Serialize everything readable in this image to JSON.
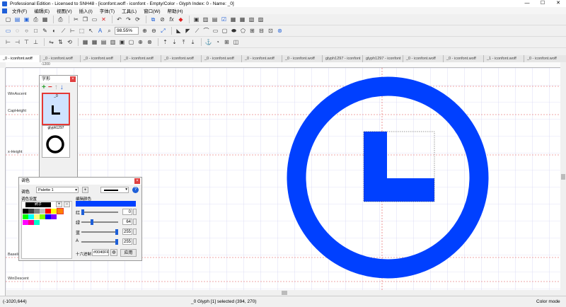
{
  "window": {
    "title": "Professional Edition - Licensed to SNH48 - [iconfont.woff - iconfont - Empty/Color - Glyph Index: 0 - Name: _0]"
  },
  "window_controls": {
    "minimize": "—",
    "maximize": "☐",
    "close": "✕"
  },
  "menu": [
    "文件(F)",
    "编辑(E)",
    "视图(V)",
    "插入(I)",
    "字体(T)",
    "工具(L)",
    "窗口(W)",
    "帮助(H)"
  ],
  "toolbar": {
    "zoom_value": "98.55%",
    "fx_label": "fx"
  },
  "tabs": [
    "_0 - iconfont.woff",
    "_0 - iconfont.woff",
    "_0 - iconfont.woff",
    "_0 - iconfont.woff",
    "_0 - iconfont.woff",
    "_0 - iconfont.woff",
    "_0 - iconfont.woff",
    "_0 - iconfont.woff",
    "glyph1297 - iconfont",
    "glyph1297 - iconfont",
    "_0 - iconfont.woff",
    "_0 - iconfont.woff",
    "_1 - iconfont.woff",
    "_0 - iconfont.woff"
  ],
  "ruler": {
    "left_label": "-1200"
  },
  "metrics": {
    "win_ascent": "WinAscent",
    "cap_height": "CapHeight",
    "x_height": "x-Height",
    "baseline": "Baseline",
    "win_descent": "WinDescent"
  },
  "glyphs_panel": {
    "title": "字形",
    "glyphs": [
      {
        "name": "_0",
        "selected": true
      },
      {
        "name": "glyph1297",
        "selected": false
      }
    ]
  },
  "palette_panel": {
    "title": "调色",
    "label": "调色",
    "palette_select": "Palette 1",
    "palette_settings_label": "调色设置",
    "brush_label": "刷子",
    "edit_color_label": "编辑颜色",
    "hex_label": "十六进制",
    "hex_value": "#0040FF",
    "apply_button": "应用",
    "channels": [
      {
        "label": "红",
        "value": "0"
      },
      {
        "label": "绿",
        "value": "64"
      },
      {
        "label": "蓝",
        "value": "255"
      },
      {
        "label": "A",
        "value": "255"
      }
    ],
    "channel_levels": [
      0,
      0.25,
      1,
      1
    ],
    "swatches": [
      "#000000",
      "#404040",
      "#808080",
      "#c0c0c0",
      "#ff0000",
      "#ffff00",
      "#ff8000",
      "#00ff00",
      "#00ffff",
      "#ffff80",
      "#80ff00",
      "#0000ff",
      "#8000ff",
      "#ff00ff",
      "#ff0080",
      "#00ffcc"
    ],
    "edit_color": "#0040ff"
  },
  "canvas": {
    "glyph_color": "#0040ff"
  },
  "status": {
    "coords": "(-1020,644)",
    "glyph_info": "_0   Glyph [1] selected (394, 270)",
    "mode": "Color mode"
  }
}
